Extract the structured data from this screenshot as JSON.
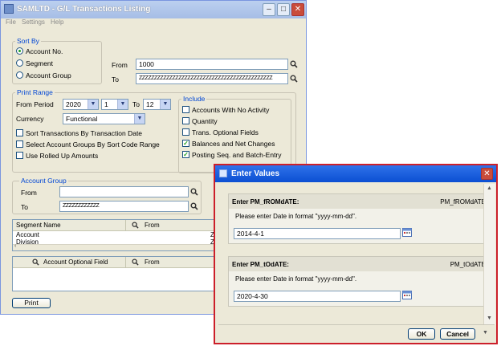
{
  "main": {
    "title": "SAMLTD - G/L Transactions Listing",
    "menu": [
      "File",
      "Settings",
      "Help"
    ],
    "sort_by": {
      "label": "Sort By",
      "options": [
        "Account No.",
        "Segment",
        "Account Group"
      ],
      "from_label": "From",
      "from_value": "1000",
      "to_label": "To",
      "to_value": "ZZZZZZZZZZZZZZZZZZZZZZZZZZZZZZZZZZZZZZZZZZZZ"
    },
    "print_range": {
      "label": "Print Range",
      "from_period_label": "From Period",
      "year": "2020",
      "period_from": "1",
      "to_label": "To",
      "period_to": "12",
      "currency_label": "Currency",
      "currency_value": "Functional",
      "checks": [
        {
          "label": "Sort Transactions By Transaction Date",
          "checked": false
        },
        {
          "label": "Select Account Groups By Sort Code Range",
          "checked": false
        },
        {
          "label": "Use Rolled Up Amounts",
          "checked": false
        }
      ]
    },
    "include": {
      "label": "Include",
      "checks": [
        {
          "label": "Accounts With No Activity",
          "checked": false
        },
        {
          "label": "Quantity",
          "checked": false
        },
        {
          "label": "Trans. Optional Fields",
          "checked": false
        },
        {
          "label": "Balances and Net Changes",
          "checked": true
        },
        {
          "label": "Posting Seq. and Batch-Entry",
          "checked": true
        }
      ]
    },
    "account_group": {
      "label": "Account Group",
      "from_label": "From",
      "from_value": "",
      "to_label": "To",
      "to_value": "ZZZZZZZZZZZZ"
    },
    "segment_grid": {
      "headers": [
        "Segment Name",
        "From"
      ],
      "rows": [
        [
          "Account",
          "",
          "ZZ"
        ],
        [
          "Division",
          "",
          "ZZ"
        ]
      ]
    },
    "optional_grid": {
      "headers": [
        "Account Optional Field",
        "From"
      ]
    },
    "print_button": "Print"
  },
  "dialog": {
    "title": "Enter Values",
    "fields": [
      {
        "name": "Enter PM_fROMdATE:",
        "tag": "PM_fROMdATE",
        "hint": "Please enter Date in format \"yyyy-mm-dd\".",
        "value": "2014-4-1"
      },
      {
        "name": "Enter PM_tOdATE:",
        "tag": "PM_tOdATE",
        "hint": "Please enter Date in format \"yyyy-mm-dd\".",
        "value": "2020-4-30"
      }
    ],
    "ok": "OK",
    "cancel": "Cancel"
  },
  "colors": {
    "group_label": "#0046d5",
    "check": "#21a121",
    "dialog_border": "#cc1f2a"
  }
}
